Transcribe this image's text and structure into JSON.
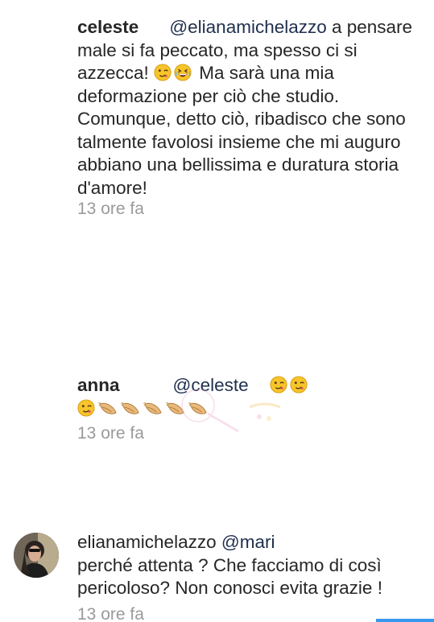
{
  "comments": [
    {
      "username": "celeste",
      "mention": "@elianamichelazzo",
      "text_1": " a pensare male si fa peccato, ma spesso ci si azzecca! ",
      "text_2": " Ma sarà una mia deformazione per ciò che studio. Comunque, detto ciò, ribadisco che sono talmente favolosi insieme che mi auguro abbiano una bellissima e duratura storia d'amore!",
      "time": "13 ore fa"
    },
    {
      "username": "anna",
      "mention": "@celeste",
      "time": "13 ore fa"
    },
    {
      "username": "elianamichelazzo",
      "mention": "@mari",
      "text": "perché attenta ? Che facciamo di così pericoloso? Non conosci evita grazie !",
      "time": "13 ore fa"
    }
  ],
  "colors": {
    "text": "#262626",
    "timestamp": "#9a9a9a",
    "mention": "#1f2f4d",
    "accent": "#3897f0"
  },
  "icons": [
    "winking-face-emoji",
    "grinning-squinting-face-emoji",
    "clapping-hands-emoji"
  ]
}
